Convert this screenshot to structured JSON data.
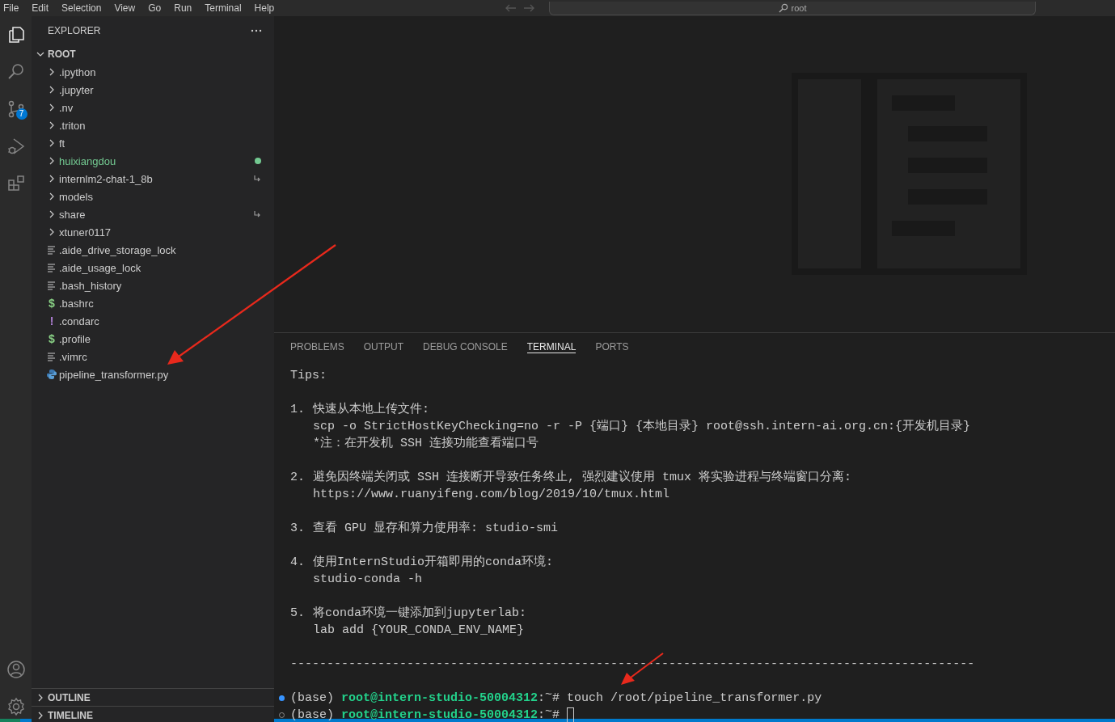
{
  "menu_bar": {
    "items": [
      "File",
      "Edit",
      "Selection",
      "View",
      "Go",
      "Run",
      "Terminal",
      "Help"
    ],
    "command_center": {
      "label": "root"
    }
  },
  "activity_bar": {
    "items": [
      {
        "kind": "explorer",
        "selected": true
      },
      {
        "kind": "search",
        "selected": false
      },
      {
        "kind": "source-control",
        "selected": false,
        "badge": "7"
      },
      {
        "kind": "run-debug",
        "selected": false
      },
      {
        "kind": "extensions",
        "selected": false
      }
    ],
    "bottom_items": [
      {
        "kind": "account"
      },
      {
        "kind": "settings"
      }
    ]
  },
  "sidebar": {
    "title": "EXPLORER",
    "root": {
      "label": "ROOT",
      "expanded": true,
      "children": [
        {
          "label": ".ipython",
          "kind": "folder",
          "expanded": false
        },
        {
          "label": ".jupyter",
          "kind": "folder",
          "expanded": false
        },
        {
          "label": ".nv",
          "kind": "folder",
          "expanded": false
        },
        {
          "label": ".triton",
          "kind": "folder",
          "expanded": false
        },
        {
          "label": "ft",
          "kind": "folder",
          "expanded": false
        },
        {
          "label": "huixiangdou",
          "kind": "folder",
          "expanded": false,
          "untracked": true,
          "color": "#73c991"
        },
        {
          "label": "internlm2-chat-1_8b",
          "kind": "folder",
          "expanded": false,
          "symlink": true
        },
        {
          "label": "models",
          "kind": "folder",
          "expanded": false
        },
        {
          "label": "share",
          "kind": "folder",
          "expanded": false,
          "symlink": true
        },
        {
          "label": "xtuner0117",
          "kind": "folder",
          "expanded": false
        },
        {
          "label": ".aide_drive_storage_lock",
          "kind": "text"
        },
        {
          "label": ".aide_usage_lock",
          "kind": "text"
        },
        {
          "label": ".bash_history",
          "kind": "text"
        },
        {
          "label": ".bashrc",
          "kind": "shell",
          "icon": "$"
        },
        {
          "label": ".condarc",
          "kind": "config",
          "icon": "!"
        },
        {
          "label": ".profile",
          "kind": "shell",
          "icon": "$"
        },
        {
          "label": ".vimrc",
          "kind": "text"
        },
        {
          "label": "pipeline_transformer.py",
          "kind": "python",
          "annotated": true
        }
      ]
    },
    "sections": [
      {
        "label": "OUTLINE",
        "expanded": false
      },
      {
        "label": "TIMELINE",
        "expanded": false
      }
    ]
  },
  "panel": {
    "tabs": [
      {
        "label": "PROBLEMS",
        "selected": false
      },
      {
        "label": "OUTPUT",
        "selected": false
      },
      {
        "label": "DEBUG CONSOLE",
        "selected": false
      },
      {
        "label": "TERMINAL",
        "selected": true
      },
      {
        "label": "PORTS",
        "selected": false
      }
    ],
    "terminal": {
      "heading": "Tips:",
      "tips": [
        {
          "number": "1.",
          "lines": [
            "快速从本地上传文件:",
            "scp -o StrictHostKeyChecking=no -r -P {端口} {本地目录} root@ssh.intern-ai.org.cn:{开发机目录}",
            "*注：在开发机 SSH 连接功能查看端口号"
          ]
        },
        {
          "number": "2.",
          "lines": [
            "避免因终端关闭或 SSH 连接断开导致任务终止, 强烈建议使用 tmux 将实验进程与终端窗口分离:",
            "https://www.ruanyifeng.com/blog/2019/10/tmux.html"
          ]
        },
        {
          "number": "3.",
          "lines": [
            "查看 GPU 显存和算力使用率: studio-smi"
          ]
        },
        {
          "number": "4.",
          "lines": [
            "使用InternStudio开箱即用的conda环境:",
            "studio-conda -h"
          ]
        },
        {
          "number": "5.",
          "lines": [
            "将conda环境一键添加到jupyterlab:",
            "lab add {YOUR_CONDA_ENV_NAME}"
          ]
        }
      ],
      "separator": "----------------------------------------------------------------------------------------------",
      "prompts": [
        {
          "completed": true,
          "env": "(base)",
          "user_host": "root@intern-studio-50004312",
          "colon": ":",
          "path": "~",
          "symbol": "#",
          "command": "touch /root/pipeline_transformer.py",
          "annotated": true
        },
        {
          "completed": false,
          "env": "(base)",
          "user_host": "root@intern-studio-50004312",
          "colon": ":",
          "path": "~",
          "symbol": "#",
          "cursor": true
        }
      ]
    }
  }
}
